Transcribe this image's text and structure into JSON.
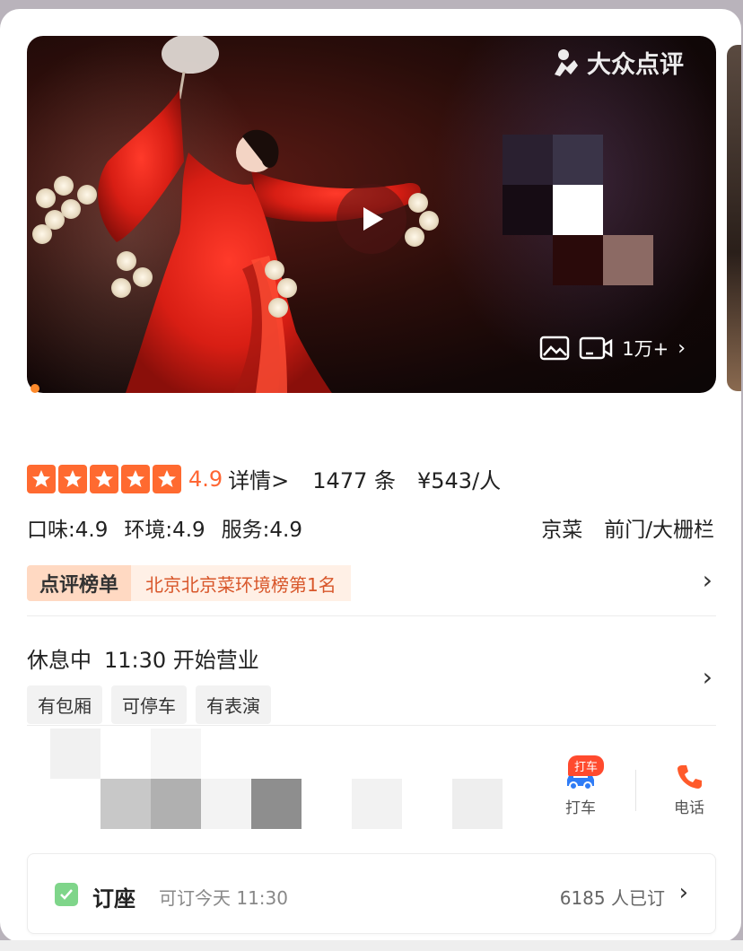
{
  "brand": {
    "name": "大众点评",
    "icon": "dianping-logo-icon"
  },
  "media": {
    "counter": "1万+",
    "icons": [
      "image-icon",
      "video-icon",
      "chevron-right-icon"
    ]
  },
  "rating": {
    "score": "4.9",
    "details_label": "详情>",
    "reviews": "1477 条",
    "price": "¥543/人",
    "stars": 5
  },
  "sub_scores": {
    "taste": "口味:4.9",
    "environment": "环境:4.9",
    "service": "服务:4.9"
  },
  "category": {
    "cuisine": "京菜",
    "area": "前门/大栅栏"
  },
  "rank": {
    "badge": "点评榜单",
    "text": "北京北京菜环境榜第1名"
  },
  "status": {
    "state": "休息中",
    "hours": "11:30 开始营业"
  },
  "tags": [
    "有包厢",
    "可停车",
    "有表演"
  ],
  "actions": {
    "taxi_badge": "打车",
    "taxi_label": "打车",
    "phone_label": "电话"
  },
  "booking": {
    "title": "订座",
    "availability": "可订今天 11:30",
    "booked": "6185 人已订"
  },
  "colors": {
    "accent": "#ff6633",
    "star": "#ff6a30",
    "rank_text": "#d8562a",
    "check": "#7fd58a",
    "phone": "#ff5a2a",
    "taxi": "#2f7cf6"
  }
}
